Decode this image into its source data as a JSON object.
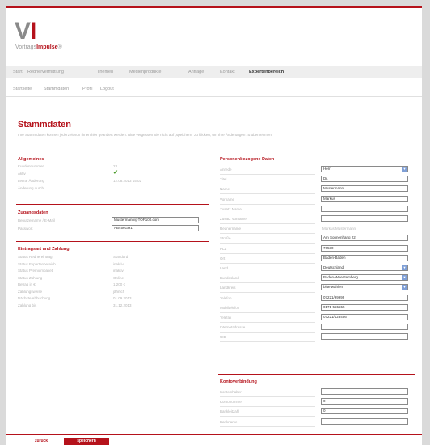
{
  "logo": {
    "letters_v": "V",
    "letters_i": "I",
    "sub_plain": "Vortrags",
    "sub_accent": "Impulse",
    "sub_mark": "®"
  },
  "topnav": [
    "Start",
    "Rednervermittlung",
    "Themen",
    "Medienprodukte",
    "Anfrage",
    "Kontakt",
    "Expertenbereich"
  ],
  "subnav": [
    "Startseite",
    "Stammdaten",
    "Profil",
    "Logout"
  ],
  "page": {
    "title": "Stammdaten",
    "description": "Ihre Stammdaten können jederzeit von Ihnen hier geändert werden. Bitte vergessen Sie nicht auf „speichern“ zu klicken, um Ihre Änderungen zu übernehmen."
  },
  "allgemeines": {
    "title": "Allgemeines",
    "rows": [
      {
        "label": "Kundennummer",
        "value": "23"
      },
      {
        "label": "Aktiv",
        "value": "✔"
      },
      {
        "label": "Letzte Änderung",
        "value": "12.08.2013 15:02"
      },
      {
        "label": "Änderung durch",
        "value": ""
      }
    ]
  },
  "zugangsdaten": {
    "title": "Zugangsdaten",
    "username_label": "Benutzername / E-Mail",
    "username_value": "Mustermann@TOP100.com",
    "password_label": "Passwort",
    "password_value": "AB456GH1"
  },
  "eintragsart": {
    "title": "Eintragsart und Zahlung",
    "rows": [
      {
        "label": "Status Rednereintrag",
        "value": "Standard"
      },
      {
        "label": "Status Expertenbereich",
        "value": "inaktiv"
      },
      {
        "label": "Status Premiumpaket",
        "value": "inaktiv"
      },
      {
        "label": "Status Zahlung",
        "value": "Online"
      },
      {
        "label": "Betrag in €",
        "value": "1.200 €"
      },
      {
        "label": "Zahlungsweise",
        "value": "jährlich"
      },
      {
        "label": "Nächste Abbuchung",
        "value": "01.09.2013"
      },
      {
        "label": "Zahlung bis",
        "value": "31.12.2013"
      }
    ]
  },
  "personen": {
    "title": "Personenbezogene Daten",
    "rows": [
      {
        "label": "Anrede",
        "value": "Herr",
        "kind": "select"
      },
      {
        "label": "Titel",
        "value": "Dr.",
        "kind": "input"
      },
      {
        "label": "Name",
        "value": "Mustermann",
        "kind": "input"
      },
      {
        "label": "Vorname",
        "value": "Markus",
        "kind": "input"
      },
      {
        "label": "Zusatz Name",
        "value": "",
        "kind": "input"
      },
      {
        "label": "Zusatz Vorname",
        "value": "",
        "kind": "input"
      },
      {
        "label": "Rednername",
        "value": "Markus Mustermann",
        "kind": "text"
      },
      {
        "label": "Straße",
        "value": "Am Sonnenhang 22",
        "kind": "input"
      },
      {
        "label": "PLZ",
        "value": "76530",
        "kind": "input"
      },
      {
        "label": "Ort",
        "value": "Baden-Baden",
        "kind": "input"
      },
      {
        "label": "Land",
        "value": "Deutschland",
        "kind": "select"
      },
      {
        "label": "Bundesland",
        "value": "Baden-Wuerttemberg",
        "kind": "select"
      },
      {
        "label": "Landkreis",
        "value": "bitte wählen",
        "kind": "select"
      },
      {
        "label": "Telefon",
        "value": "07221/99999",
        "kind": "input"
      },
      {
        "label": "Mobiltelefon",
        "value": "0171-555555",
        "kind": "input"
      },
      {
        "label": "Telefax",
        "value": "07221/123456",
        "kind": "input"
      },
      {
        "label": "Internetadresse",
        "value": "",
        "kind": "input"
      },
      {
        "label": "UID",
        "value": "",
        "kind": "input"
      }
    ]
  },
  "konto": {
    "title": "Kontoverbindung",
    "rows": [
      {
        "label": "Kontoinhaber",
        "value": ""
      },
      {
        "label": "Kontonummer",
        "value": "0"
      },
      {
        "label": "Bankleitzahl",
        "value": "0"
      },
      {
        "label": "Bankname",
        "value": ""
      }
    ]
  },
  "buttons": {
    "back": "zurück",
    "save": "speichern"
  },
  "colors": {
    "accent": "#b5121b",
    "select_arrow": "#7f9fd6",
    "check": "#4a9a2a"
  }
}
